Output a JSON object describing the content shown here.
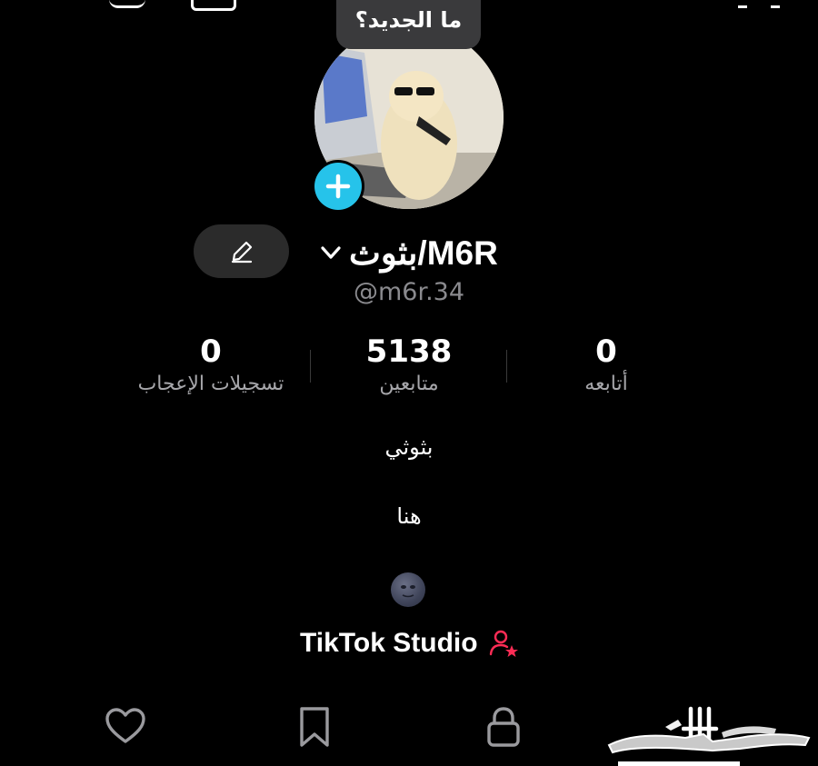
{
  "tooltip": {
    "text": "ما الجديد؟"
  },
  "profile": {
    "display_name": "بثوث/M6R",
    "handle": "@m6r.34",
    "bio_lines": [
      "بثوثي",
      "هنا"
    ],
    "bio_emoji": "moon-face-emoji"
  },
  "stats": [
    {
      "value": "0",
      "label": "تسجيلات الإعجاب"
    },
    {
      "value": "5138",
      "label": "متابعين"
    },
    {
      "value": "0",
      "label": "أتابعه"
    }
  ],
  "studio": {
    "label": "TikTok Studio",
    "icon": "creator-star-icon"
  },
  "tabs": [
    {
      "name": "liked",
      "icon": "heart-icon"
    },
    {
      "name": "saved",
      "icon": "bookmark-icon"
    },
    {
      "name": "private",
      "icon": "lock-icon"
    },
    {
      "name": "videos",
      "icon": "grid-icon"
    }
  ],
  "colors": {
    "accent": "#26c3ea",
    "studio_icon": "#fe2c55",
    "background": "#000000"
  }
}
